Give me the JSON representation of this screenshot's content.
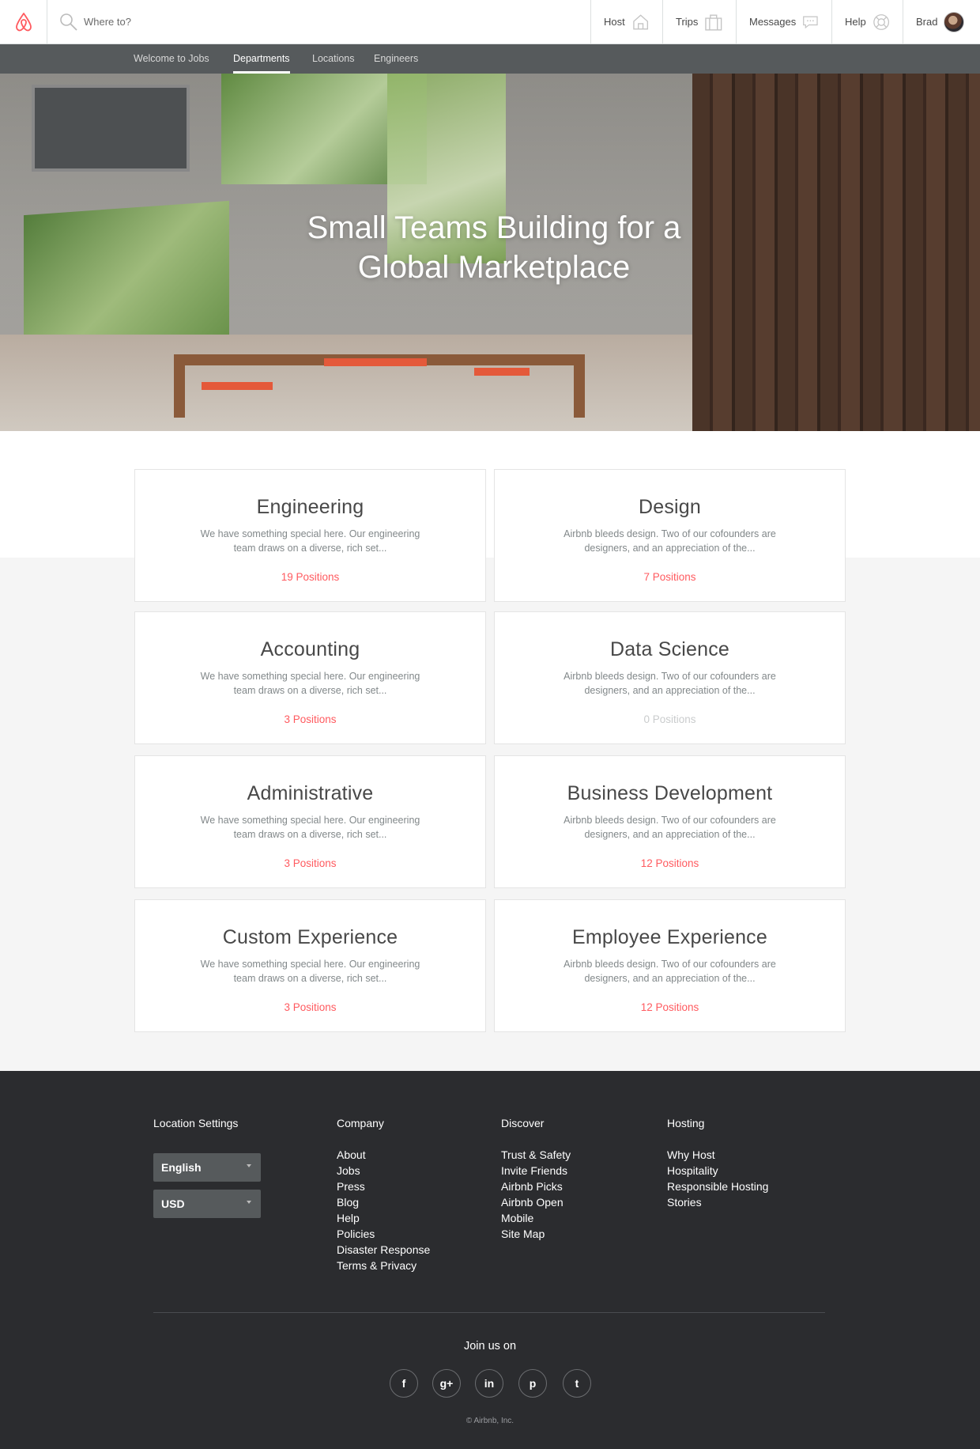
{
  "header": {
    "search_placeholder": "Where to?",
    "nav": {
      "host": "Host",
      "trips": "Trips",
      "messages": "Messages",
      "help": "Help",
      "user": "Brad"
    },
    "brand_color": "#ff5a5f"
  },
  "subnav": {
    "items": [
      "Welcome to Jobs",
      "Departments",
      "Locations",
      "Engineers"
    ],
    "active": "Departments"
  },
  "hero": {
    "title_line1": "Small Teams Building for a",
    "title_line2": "Global Marketplace"
  },
  "departments": [
    {
      "name": "Engineering",
      "desc": "We have something special here. Our engineering team draws on a diverse, rich set...",
      "positions": "19 Positions"
    },
    {
      "name": "Design",
      "desc": "Airbnb bleeds design. Two of our cofounders are designers, and an appreciation of the...",
      "positions": "7 Positions"
    },
    {
      "name": "Accounting",
      "desc": "We have something special here. Our engineering team draws on a diverse, rich set...",
      "positions": "3 Positions"
    },
    {
      "name": "Data Science",
      "desc": "Airbnb bleeds design. Two of our cofounders are designers, and an appreciation of the...",
      "positions": "0 Positions"
    },
    {
      "name": "Administrative",
      "desc": "We have something special here. Our engineering team draws on a diverse, rich set...",
      "positions": "3 Positions"
    },
    {
      "name": "Business Development",
      "desc": "Airbnb bleeds design. Two of our cofounders are designers, and an appreciation of the...",
      "positions": "12 Positions"
    },
    {
      "name": "Custom Experience",
      "desc": "We have something special here. Our engineering team draws on a diverse, rich set...",
      "positions": "3 Positions"
    },
    {
      "name": "Employee Experience",
      "desc": "Airbnb bleeds design. Two of our cofounders are designers, and an appreciation of the...",
      "positions": "12 Positions"
    }
  ],
  "footer": {
    "location_settings": {
      "title": "Location Settings",
      "language": "English",
      "currency": "USD"
    },
    "company": {
      "title": "Company",
      "links": [
        "About",
        "Jobs",
        "Press",
        "Blog",
        "Help",
        "Policies",
        "Disaster Response",
        "Terms & Privacy"
      ]
    },
    "discover": {
      "title": "Discover",
      "links": [
        "Trust & Safety",
        "Invite Friends",
        "Airbnb Picks",
        "Airbnb Open",
        "Mobile",
        "Site Map"
      ]
    },
    "hosting": {
      "title": "Hosting",
      "links": [
        "Why Host",
        "Hospitality",
        "Responsible Hosting",
        "Stories"
      ]
    },
    "join_label": "Join us on",
    "social": [
      {
        "icon": "facebook-icon",
        "glyph": "f"
      },
      {
        "icon": "google-plus-icon",
        "glyph": "g+"
      },
      {
        "icon": "linkedin-icon",
        "glyph": "in"
      },
      {
        "icon": "pinterest-icon",
        "glyph": "p"
      },
      {
        "icon": "twitter-icon",
        "glyph": "t"
      }
    ],
    "copyright": "© Airbnb, Inc."
  }
}
